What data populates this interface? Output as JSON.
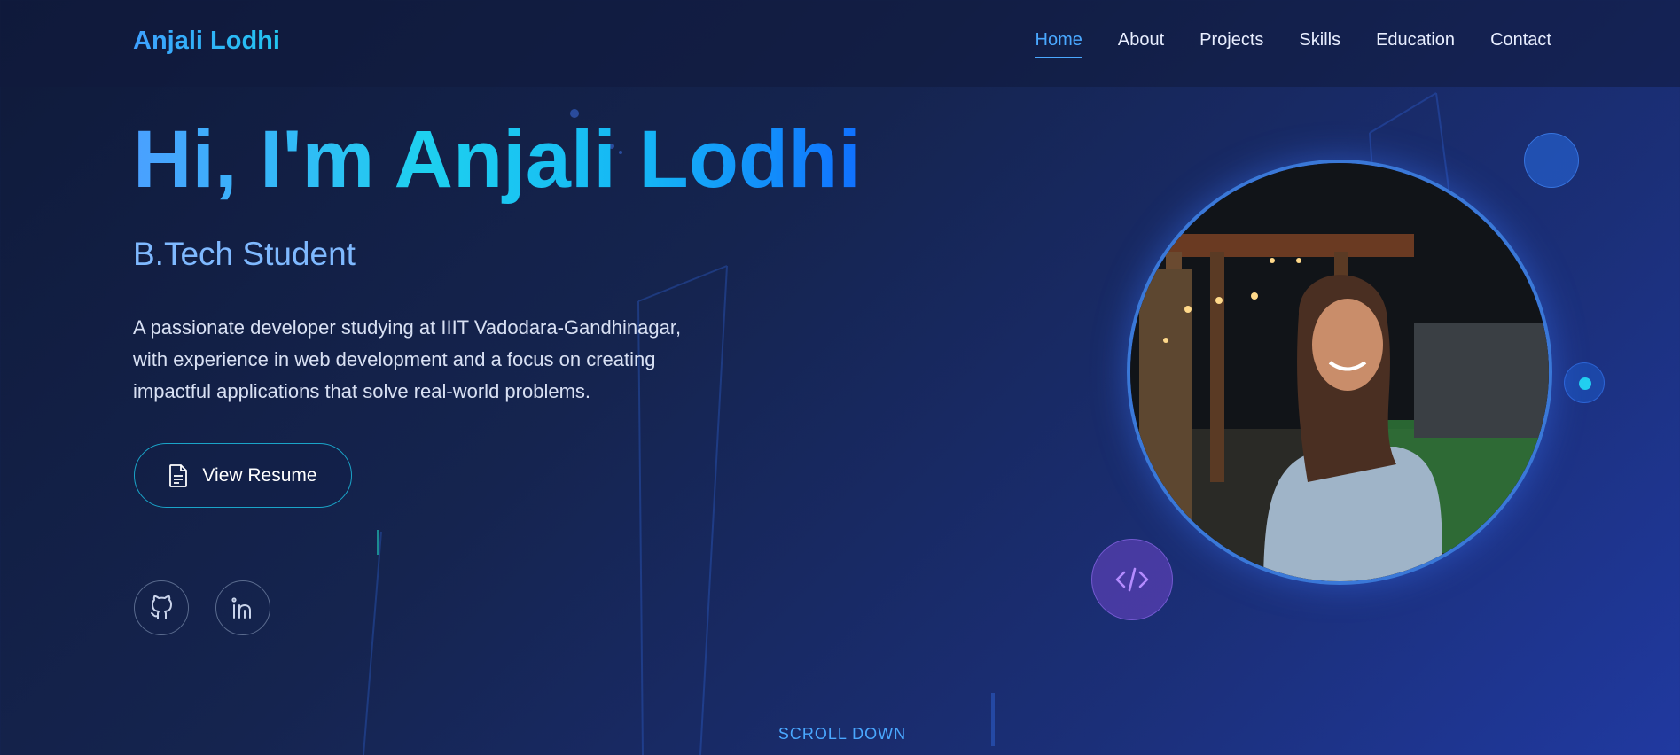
{
  "header": {
    "logo": "Anjali Lodhi",
    "nav": [
      "Home",
      "About",
      "Projects",
      "Skills",
      "Education",
      "Contact"
    ],
    "active_nav": "Home"
  },
  "hero": {
    "title": "Hi, I'm Anjali Lodhi",
    "subtitle": "B.Tech Student",
    "description": "A passionate developer studying at IIIT Vadodara-Gandhinagar, with experience in web development and a focus on creating impactful applications that solve real-world problems.",
    "resume_button": "View Resume",
    "scroll_label": "SCROLL DOWN"
  },
  "icons": {
    "resume": "document-icon",
    "github": "github-icon",
    "linkedin": "linkedin-icon",
    "code": "code-icon"
  },
  "colors": {
    "accent": "#4aa8ff",
    "title_gradient_start": "#4aa0ff",
    "title_gradient_end": "#1070ff",
    "button_border": "#1aa4c8",
    "code_badge": "#6e46c8"
  }
}
